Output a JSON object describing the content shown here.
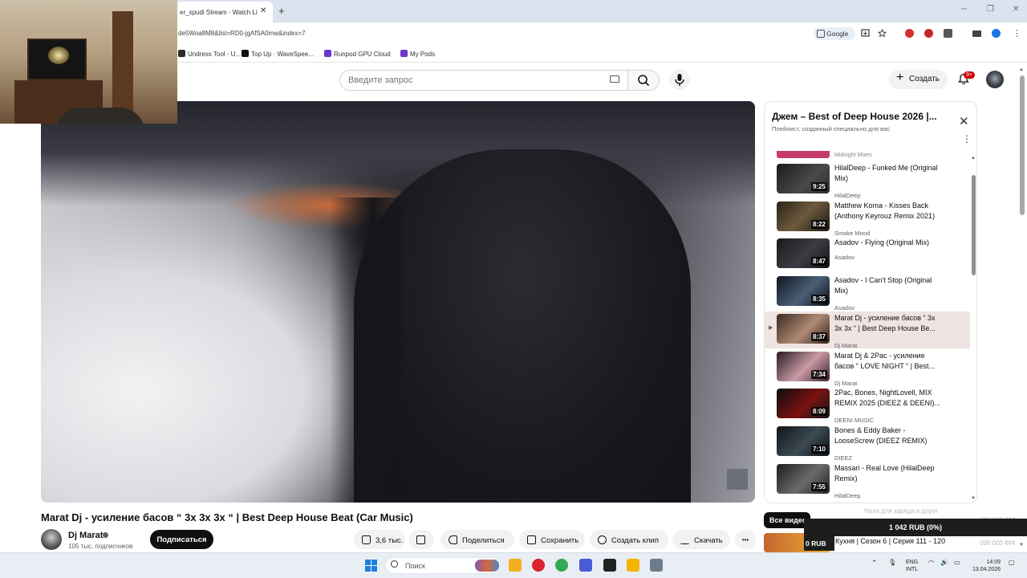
{
  "browser": {
    "tab_title": "er_spudi Stream - Watch Li",
    "tab_close": "✕",
    "new_tab": "+",
    "url": "de5Woa8M8&list=RD0-jgAfSA0mw&index=7",
    "google_chip": "Google",
    "window_controls": [
      "─",
      "❐",
      "✕"
    ],
    "bookmarks": [
      {
        "label": "Undress Tool - U...",
        "color": "#2b2b2b"
      },
      {
        "label": "Top Up · WaveSpee...",
        "color": "#111111"
      },
      {
        "label": "Runpod GPU Cloud",
        "color": "#6b36c9"
      },
      {
        "label": "My Pods",
        "color": "#6b36c9"
      }
    ],
    "extension_colors": [
      "#d32f2f",
      "#c62828",
      "#555555",
      "#444444",
      "#1a73e8"
    ]
  },
  "header": {
    "search_placeholder": "Введите запрос",
    "create_label": "Создать",
    "create_plus": "+",
    "notif_badge": "9+"
  },
  "video": {
    "title": "Marat Dj - усиление басов “ 3x 3x 3x “ | Best Deep House Beat (Car Music)",
    "channel_name": "Dj Marat",
    "subscribers": "105 тыс. подписчиков",
    "subscribe_label": "Подписаться",
    "likes": "3,6 тыс.",
    "share_label": "Поделиться",
    "save_label": "Сохранить",
    "clip_label": "Создать клип",
    "download_label": "Скачать",
    "more_label": "•••"
  },
  "playlist": {
    "title": "Джем – Best of Deep House 2026 |...",
    "subtitle": "Плейлист, созданный специально для вас",
    "close": "✕",
    "more": "⋮",
    "top_fragment": "Midnight Mixes",
    "items": [
      {
        "title": "HilalDeep - Funked Me (Original Mix)",
        "author": "HilalDeep",
        "duration": "9:25",
        "thumb": "linear-gradient(135deg,#1b1b1b,#4a4a4a 60%,#2a2a2a)",
        "active": false
      },
      {
        "title": "Matthew Koma - Kisses Back (Anthony Keyrouz Remix 2021)",
        "author": "Smoke Mood",
        "duration": "8:22",
        "thumb": "linear-gradient(135deg,#2a2219,#6d5a3c 50%,#1c1712)",
        "active": false
      },
      {
        "title": "Asadov - Flying (Original Mix)",
        "author": "Asadov",
        "duration": "8:47",
        "thumb": "linear-gradient(135deg,#1a1a1d,#3c3d44 55%,#111114)",
        "active": false
      },
      {
        "title": "Asadov - I Can't Stop (Original Mix)",
        "author": "Asadov",
        "duration": "8:35",
        "thumb": "linear-gradient(135deg,#10161f,#4a5f78 55%,#0b0f15)",
        "active": false
      },
      {
        "title": "Marat Dj - усиление басов “ 3x 3x 3x “ | Best Deep House Be...",
        "author": "Dj Marat",
        "duration": "8:37",
        "thumb": "linear-gradient(135deg,#3a2a22,#b08a74 55%,#2c1e18)",
        "active": true
      },
      {
        "title": "Marat Dj & 2Pac - усиление басов “ LOVE NIGHT “ | Best...",
        "author": "Dj Marat",
        "duration": "7:34",
        "thumb": "linear-gradient(135deg,#2a1a1e,#c99aa6 55%,#3a1f27)",
        "active": false
      },
      {
        "title": "2Pac, Bones, NightLovell, MIX REMIX 2025 (DIEEZ & DEENI)...",
        "author": "DEENI MUSIC",
        "duration": "8:09",
        "thumb": "linear-gradient(135deg,#0d0d0f,#7a1111 55%,#151515)",
        "active": false
      },
      {
        "title": "Bones & Eddy Baker - LooseScrew (DIEEZ REMIX)",
        "author": "DIEEZ",
        "duration": "7:10",
        "thumb": "linear-gradient(135deg,#0f1418,#3c4a53 55%,#0a0e12)",
        "active": false
      },
      {
        "title": "Massari - Real Love (HilalDeep Remix)",
        "author": "HilalDeep",
        "duration": "7:55",
        "thumb": "linear-gradient(135deg,#1d1d1d,#6a6a6a 55%,#222222)",
        "active": false
      }
    ]
  },
  "overlay": {
    "all_videos_chip": "Все видео",
    "ghost_text_1": "Нахи для заряда в дорог",
    "ghost_text_2": "000 000 ¢¢¢",
    "ghost_text_3": "000 000 ¢¢¢",
    "rub_balance": "1 042 RUB (0%)",
    "rub_small": "0 RUB",
    "next_title": "Кухня | Сезон 6 | Серия 111 - 120"
  },
  "taskbar": {
    "search_label": "Поиск",
    "lang_top": "ENG",
    "lang_bottom": "INTL",
    "time": "14:09",
    "date": "13.04.2026",
    "app_colors": [
      "#f2b01e",
      "#d9232e",
      "#34a853",
      "#4a5bd6",
      "#222222",
      "#f5b400",
      "#6d7b8d"
    ]
  }
}
